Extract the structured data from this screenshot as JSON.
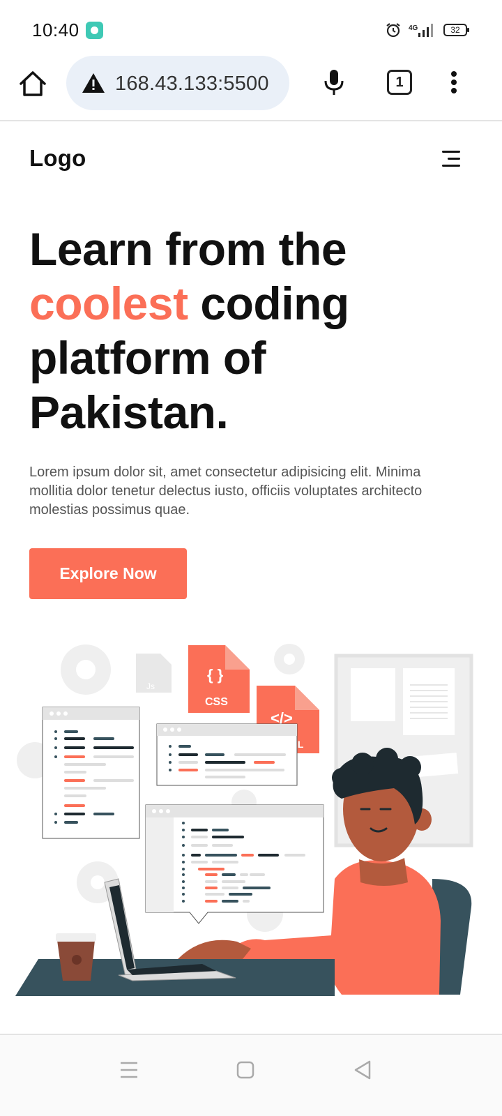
{
  "status_bar": {
    "time": "10:40",
    "network": "4G",
    "battery": "32",
    "icons": [
      "app-icon",
      "alarm-icon",
      "signal-icon",
      "battery-icon"
    ]
  },
  "browser": {
    "url": "168.43.133:5500",
    "tab_count": "1",
    "icons": [
      "home-icon",
      "warning-icon",
      "microphone-icon",
      "tabs-icon",
      "more-vert-icon"
    ]
  },
  "site": {
    "logo": "Logo",
    "menu_icon": "hamburger-icon"
  },
  "hero": {
    "title_line1": "Learn from the",
    "title_accent": "coolest",
    "title_rest": " coding platform of Pakistan.",
    "description": "Lorem ipsum dolor sit, amet consectetur adipisicing elit. Minima mollitia dolor tenetur delectus iusto, officiis voluptates architecto molestias possimus quae.",
    "cta_label": "Explore Now",
    "accent_color": "#fb6f57"
  },
  "illustration": {
    "badge_css": "CSS",
    "badge_braces": "{ }",
    "badge_tag": "</>",
    "badge_tag_suffix": "IL",
    "badge_js": "Js"
  },
  "nav_bar": {
    "icons": [
      "recent-apps-icon",
      "home-square-icon",
      "back-triangle-icon"
    ]
  }
}
